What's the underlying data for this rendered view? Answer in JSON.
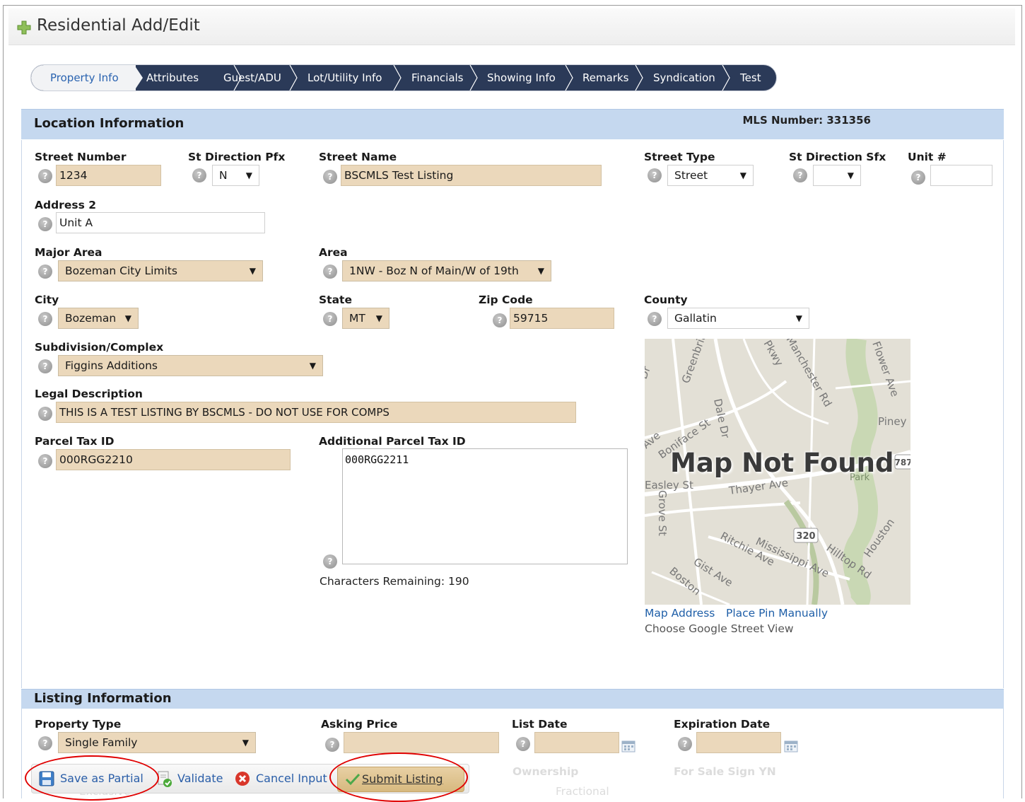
{
  "window": {
    "title": "Residential Add/Edit"
  },
  "tabs": [
    {
      "label": "Property Info",
      "active": true
    },
    {
      "label": "Attributes"
    },
    {
      "label": "Guest/ADU"
    },
    {
      "label": "Lot/Utility Info"
    },
    {
      "label": "Financials"
    },
    {
      "label": "Showing Info"
    },
    {
      "label": "Remarks"
    },
    {
      "label": "Syndication"
    },
    {
      "label": "Test"
    }
  ],
  "location": {
    "title": "Location Information",
    "mls_number": "MLS Number: 331356",
    "street_number": {
      "label": "Street Number",
      "value": "1234"
    },
    "st_direction_pfx": {
      "label": "St Direction Pfx",
      "value": "N"
    },
    "street_name": {
      "label": "Street Name",
      "value": "BSCMLS Test Listing"
    },
    "street_type": {
      "label": "Street Type",
      "value": "Street"
    },
    "st_direction_sfx": {
      "label": "St Direction Sfx",
      "value": ""
    },
    "unit": {
      "label": "Unit #",
      "value": ""
    },
    "address2": {
      "label": "Address 2",
      "value": "Unit A"
    },
    "major_area": {
      "label": "Major Area",
      "value": "Bozeman City Limits"
    },
    "area": {
      "label": "Area",
      "value": "1NW - Boz N of Main/W of 19th"
    },
    "city": {
      "label": "City",
      "value": "Bozeman"
    },
    "state": {
      "label": "State",
      "value": "MT"
    },
    "zip": {
      "label": "Zip Code",
      "value": "59715"
    },
    "county": {
      "label": "County",
      "value": "Gallatin"
    },
    "subdivision": {
      "label": "Subdivision/Complex",
      "value": "Figgins Additions"
    },
    "legal": {
      "label": "Legal Description",
      "value": "THIS IS A TEST LISTING BY BSCMLS - DO NOT USE FOR COMPS"
    },
    "parcel": {
      "label": "Parcel Tax ID",
      "value": "000RGG2210"
    },
    "add_parcel": {
      "label": "Additional Parcel Tax ID",
      "value": "000RGG2211"
    },
    "chars_remaining": "Characters Remaining: 190",
    "map": {
      "caption": "Map Not Found",
      "streets": [
        "Dale Dr",
        "Greenbriar",
        "Manchester Rd",
        "Flower Ave",
        "Piney",
        "Boniface St",
        "Thayer Ave",
        "Easley St",
        "Grove St",
        "Ritchie Ave",
        "Mississippi Ave",
        "Hilltop Rd",
        "Houston",
        "Boston",
        "Park",
        "Pkwy",
        "Ave",
        "Dr",
        "Gist Ave"
      ],
      "badges": [
        "320",
        "787"
      ],
      "links": {
        "map_address": "Map Address",
        "place_pin": "Place Pin Manually",
        "street_view": "Choose Google Street View"
      }
    }
  },
  "listing": {
    "title": "Listing Information",
    "property_type": {
      "label": "Property Type",
      "value": "Single Family"
    },
    "asking_price": {
      "label": "Asking Price",
      "value": ""
    },
    "list_date": {
      "label": "List Date",
      "value": ""
    },
    "expiration_date": {
      "label": "Expiration Date",
      "value": ""
    },
    "hidden_labels": {
      "ownership": "Ownership",
      "fractional": "Fractional",
      "for_sale_sign": "For Sale Sign YN",
      "exclusive": "Exclusive"
    }
  },
  "toolbar": {
    "save_partial": "Save as Partial",
    "validate": "Validate",
    "cancel": "Cancel Input",
    "submit": "Submit Listing"
  },
  "icons": {
    "help": "?",
    "dropdown": "▼"
  }
}
